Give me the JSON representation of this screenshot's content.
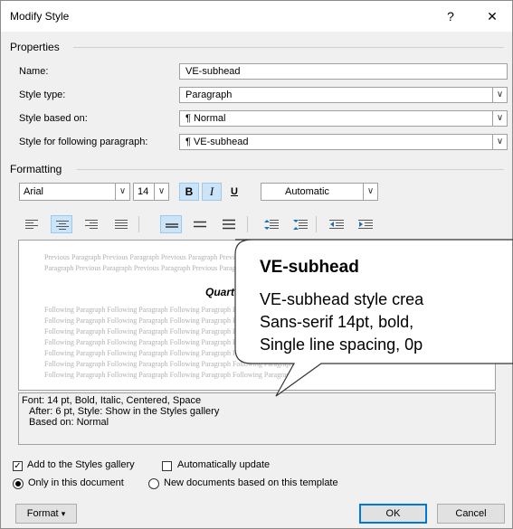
{
  "dialog": {
    "title": "Modify Style",
    "help_glyph": "?",
    "close_glyph": "✕"
  },
  "properties": {
    "heading": "Properties",
    "name_label": "Name:",
    "name_value": "VE-subhead",
    "style_type_label": "Style type:",
    "style_type_value": "Paragraph",
    "based_on_label": "Style based on:",
    "based_on_value": "¶  Normal",
    "following_label": "Style for following paragraph:",
    "following_value": "¶  VE-subhead"
  },
  "formatting": {
    "heading": "Formatting",
    "font": "Arial",
    "size": "14",
    "bold": "B",
    "italic": "I",
    "underline": "U",
    "color": "Automatic"
  },
  "preview": {
    "prev_1": "Previous Paragraph Previous Paragraph Previous Paragraph Previous Paragraph Previous Paragraph",
    "prev_2": "Paragraph Previous Paragraph Previous Paragraph Previous Paragraph Previous Paragraph",
    "main_text": "Quarte",
    "follow_lines": [
      "Following Paragraph Following Paragraph Following Paragraph Following Paragraph",
      "Following Paragraph Following Paragraph Following Paragraph Following Paragraph",
      "Following Paragraph Following Paragraph Following Paragraph Following Paragraph",
      "Following Paragraph Following Paragraph Following Paragraph Following Paragraph",
      "Following Paragraph Following Paragraph Following Paragraph Following Paragraph",
      "Following Paragraph Following Paragraph Following Paragraph Following Paragraph",
      "Following Paragraph Following Paragraph Following Paragraph Following Paragraph"
    ]
  },
  "description": {
    "line1": "Font: 14 pt, Bold, Italic, Centered, Space",
    "line2": "After:  6 pt, Style: Show in the Styles gallery",
    "line3": "Based on: Normal"
  },
  "options": {
    "add_gallery": "Add to the Styles gallery",
    "auto_update": "Automatically update",
    "only_doc": "Only in this document",
    "new_docs": "New documents based on this template"
  },
  "buttons": {
    "format": "Format",
    "format_arrow": "▾",
    "ok": "OK",
    "cancel": "Cancel"
  },
  "callout": {
    "title": "VE-subhead",
    "line1": "VE-subhead style crea",
    "line2": "Sans-serif 14pt, bold,",
    "line3": "Single line spacing, 0p"
  },
  "colors": {
    "accent": "#0078d7",
    "pressed": "#cce4f7",
    "dialog_bg": "#f0f0f0"
  }
}
